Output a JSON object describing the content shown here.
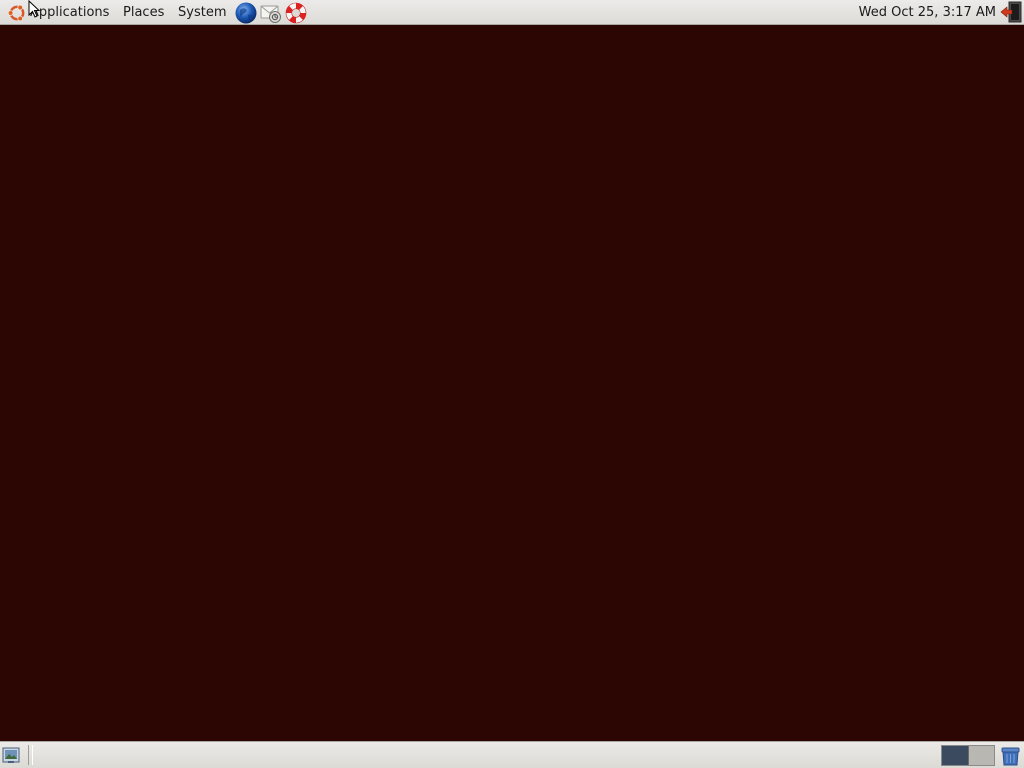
{
  "top_panel": {
    "menus": [
      {
        "label": "Applications"
      },
      {
        "label": "Places"
      },
      {
        "label": "System"
      }
    ],
    "launchers": [
      {
        "icon": "web-browser-icon"
      },
      {
        "icon": "email-client-icon"
      },
      {
        "icon": "help-lifebuoy-icon"
      }
    ],
    "clock": "Wed Oct 25,  3:17 AM",
    "logout_icon": "logout-icon"
  },
  "bottom_panel": {
    "show_desktop_icon": "show-desktop-icon",
    "workspaces": [
      {
        "name": "workspace-1",
        "active": true
      },
      {
        "name": "workspace-2",
        "active": false
      }
    ],
    "trash_icon": "trash-icon"
  },
  "colors": {
    "desktop_background": "#2c0602",
    "panel": "#dcdad5",
    "active_workspace": "#3b4a5e"
  }
}
